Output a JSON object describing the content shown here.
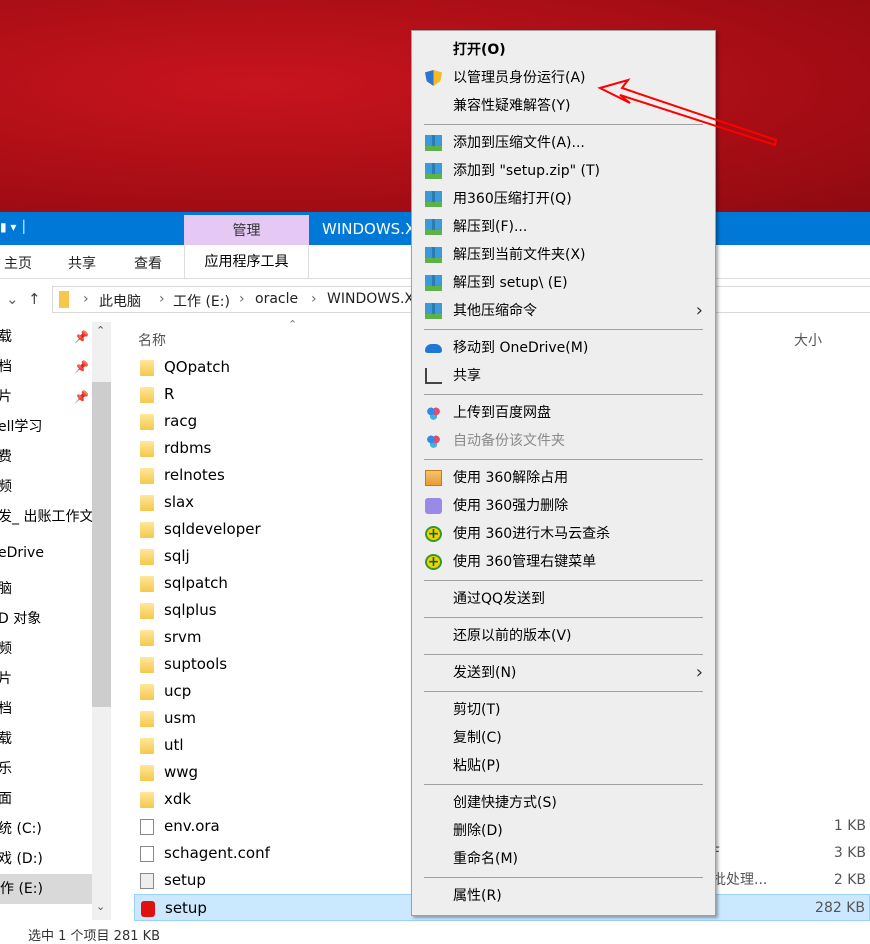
{
  "explorer": {
    "window_title": "WINDOWS.X",
    "context_tab": "管理",
    "ribbon_tabs": [
      "主页",
      "共享",
      "查看"
    ],
    "context_subtab": "应用程序工具",
    "breadcrumb": [
      "此电脑",
      "工作 (E:)",
      "oracle",
      "WINDOWS.X"
    ],
    "sidebar": [
      {
        "label": "载",
        "pinned": true
      },
      {
        "label": "档",
        "pinned": true
      },
      {
        "label": "片",
        "pinned": true
      },
      {
        "label": "ell学习"
      },
      {
        "label": "费"
      },
      {
        "label": "频"
      },
      {
        "label": "发_ 出账工作文"
      },
      {
        "label": "eDrive"
      },
      {
        "label": "脑"
      },
      {
        "label": "D 对象"
      },
      {
        "label": "频"
      },
      {
        "label": "片"
      },
      {
        "label": "档"
      },
      {
        "label": "载"
      },
      {
        "label": "乐"
      },
      {
        "label": "面"
      },
      {
        "label": "统 (C:)"
      },
      {
        "label": "戏 (D:)"
      },
      {
        "label": "作 (E:)",
        "selected": true
      }
    ],
    "columns": {
      "name": "名称",
      "size": "大小"
    },
    "files": [
      {
        "name": "QOpatch",
        "icon": "folder"
      },
      {
        "name": "R",
        "icon": "folder"
      },
      {
        "name": "racg",
        "icon": "folder"
      },
      {
        "name": "rdbms",
        "icon": "folder"
      },
      {
        "name": "relnotes",
        "icon": "folder"
      },
      {
        "name": "slax",
        "icon": "folder"
      },
      {
        "name": "sqldeveloper",
        "icon": "folder"
      },
      {
        "name": "sqlj",
        "icon": "folder"
      },
      {
        "name": "sqlpatch",
        "icon": "folder"
      },
      {
        "name": "sqlplus",
        "icon": "folder"
      },
      {
        "name": "srvm",
        "icon": "folder"
      },
      {
        "name": "suptools",
        "icon": "folder"
      },
      {
        "name": "ucp",
        "icon": "folder"
      },
      {
        "name": "usm",
        "icon": "folder"
      },
      {
        "name": "utl",
        "icon": "folder"
      },
      {
        "name": "wwg",
        "icon": "folder"
      },
      {
        "name": "xdk",
        "icon": "folder"
      },
      {
        "name": "env.ora",
        "icon": "file",
        "size": "1 KB"
      },
      {
        "name": "schagent.conf",
        "icon": "file",
        "type": "F",
        "size": "3 KB"
      },
      {
        "name": "setup",
        "icon": "bat",
        "type": "批处理...",
        "size": "2 KB"
      },
      {
        "name": "setup",
        "icon": "db",
        "size": "282 KB",
        "selected": true
      }
    ],
    "status": "选中 1 个项目  281 KB"
  },
  "context_menu": {
    "groups": [
      [
        {
          "label": "打开(O)",
          "bold": true
        },
        {
          "label": "以管理员身份运行(A)",
          "icon": "shield"
        },
        {
          "label": "兼容性疑难解答(Y)"
        }
      ],
      [
        {
          "label": "添加到压缩文件(A)...",
          "icon": "zip"
        },
        {
          "label": "添加到 \"setup.zip\" (T)",
          "icon": "zip"
        },
        {
          "label": "用360压缩打开(Q)",
          "icon": "zip"
        },
        {
          "label": "解压到(F)...",
          "icon": "zip"
        },
        {
          "label": "解压到当前文件夹(X)",
          "icon": "zip"
        },
        {
          "label": "解压到 setup\\ (E)",
          "icon": "zip"
        },
        {
          "label": "其他压缩命令",
          "icon": "zip",
          "submenu": true
        }
      ],
      [
        {
          "label": "移动到 OneDrive(M)",
          "icon": "cloud"
        },
        {
          "label": "共享",
          "icon": "share"
        }
      ],
      [
        {
          "label": "上传到百度网盘",
          "icon": "baidu"
        },
        {
          "label": "自动备份该文件夹",
          "icon": "baidu",
          "disabled": true
        }
      ],
      [
        {
          "label": "使用 360解除占用",
          "icon": "unlock"
        },
        {
          "label": "使用 360强力删除",
          "icon": "shred"
        },
        {
          "label": "使用 360进行木马云查杀",
          "icon": "plus"
        },
        {
          "label": "使用 360管理右键菜单",
          "icon": "plus"
        }
      ],
      [
        {
          "label": "通过QQ发送到"
        }
      ],
      [
        {
          "label": "还原以前的版本(V)"
        }
      ],
      [
        {
          "label": "发送到(N)",
          "submenu": true
        }
      ],
      [
        {
          "label": "剪切(T)"
        },
        {
          "label": "复制(C)"
        },
        {
          "label": "粘贴(P)"
        }
      ],
      [
        {
          "label": "创建快捷方式(S)"
        },
        {
          "label": "删除(D)"
        },
        {
          "label": "重命名(M)"
        }
      ],
      [
        {
          "label": "属性(R)"
        }
      ]
    ]
  },
  "colors": {
    "titlebar": "#0078d7",
    "context_tab": "#e6c8f4",
    "selection": "#cce8ff",
    "annotation_arrow": "#ff0000",
    "desktop": "#b0101a"
  }
}
